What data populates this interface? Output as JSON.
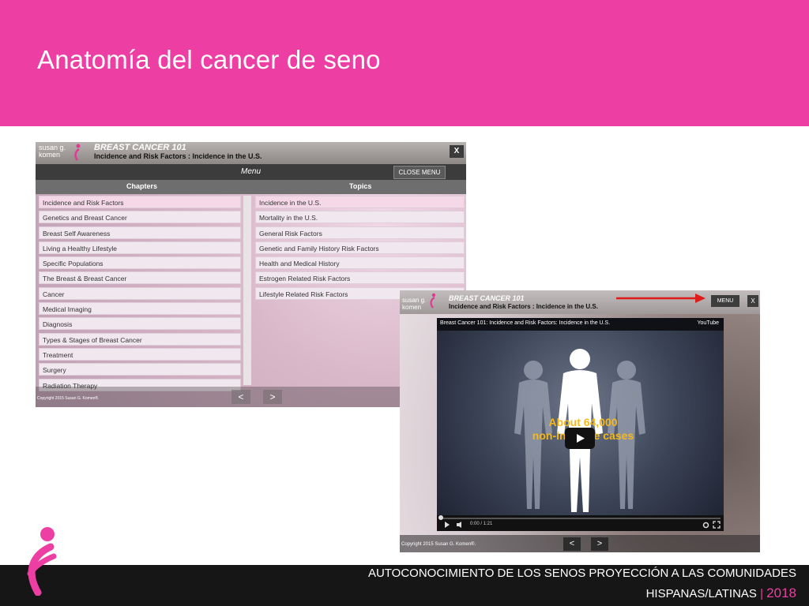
{
  "slide": {
    "title": "Anatomía del cancer de seno",
    "footer_line1": "AUTOCONOCIMIENTO DE LOS SENOS PROYECCIÓN A LAS COMUNIDADES",
    "footer_line2": "HISPANAS/LATINAS",
    "footer_separator": "|",
    "footer_year": "2018",
    "colors": {
      "header_pink": "#ec3ea3",
      "footer_dark": "#161616",
      "arrow_red": "#e01b1b"
    }
  },
  "screen1": {
    "logo_line1": "susan g.",
    "logo_line2": "komen",
    "app_title": "BREAST CANCER 101",
    "app_subtitle": "Incidence and Risk Factors : Incidence in the U.S.",
    "close_label": "X",
    "menu_label": "Menu",
    "close_menu_label": "CLOSE MENU",
    "chapters_header": "Chapters",
    "topics_header": "Topics",
    "chapters": [
      "Incidence and Risk Factors",
      "Genetics and Breast Cancer",
      "Breast Self Awareness",
      "Living a Healthy Lifestyle",
      "Specific Populations",
      "The Breast & Breast Cancer",
      "Cancer",
      "Medical Imaging",
      "Diagnosis",
      "Types & Stages of Breast Cancer",
      "Treatment",
      "Surgery",
      "Radiation Therapy"
    ],
    "topics": [
      "Incidence in the U.S.",
      "Mortality in the U.S.",
      "General Risk Factors",
      "Genetic and Family History Risk Factors",
      "Health and Medical History",
      "Estrogen Related Risk Factors",
      "Lifestyle Related Risk Factors"
    ],
    "copyright": "Copyright 2015 Susan G. Komen®.",
    "prev_label": "<",
    "next_label": ">"
  },
  "screen2": {
    "logo_line1": "susan g.",
    "logo_line2": "komen",
    "app_title": "BREAST CANCER 101",
    "app_subtitle": "Incidence and Risk Factors : Incidence in the U.S.",
    "menu_button": "MENU",
    "close_label": "X",
    "video_title": "Breast Cancer 101: Incidence and Risk Factors: Incidence in the U.S.",
    "youtube_label": "YouTube",
    "caption_line1": "About 64,000",
    "caption_line2": "non-invasive cases",
    "time_display": "0:00 / 1:21",
    "copyright": "Copyright 2015 Susan G. Komen®.",
    "prev_label": "<",
    "next_label": ">"
  }
}
